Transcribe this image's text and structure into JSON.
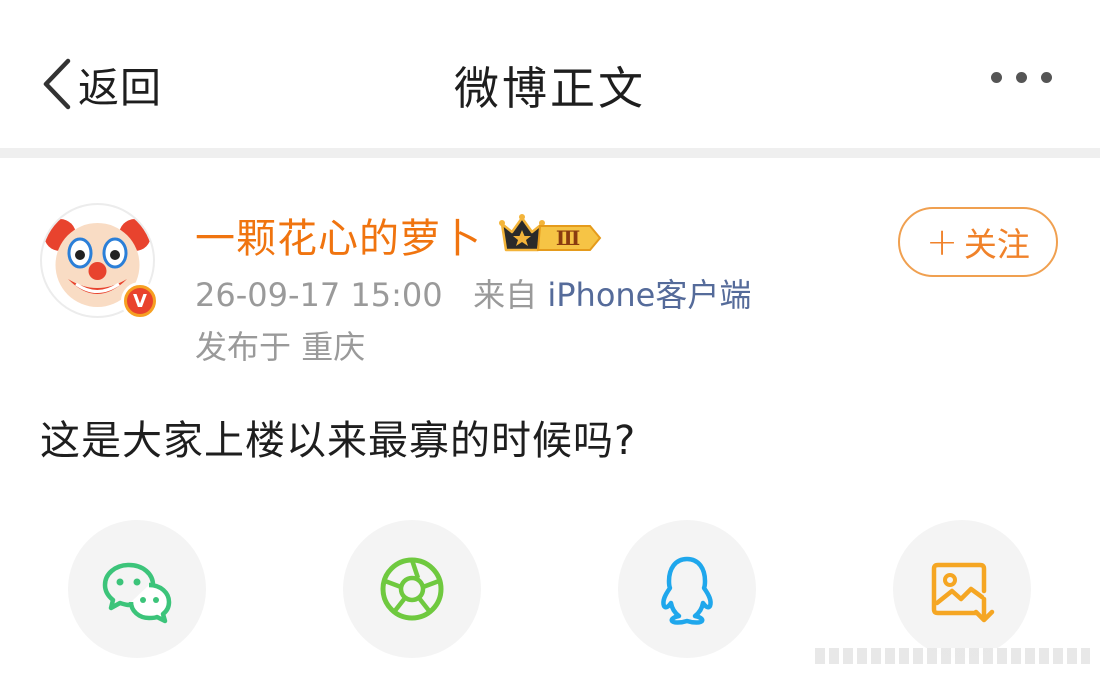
{
  "nav": {
    "back_label": "返回",
    "title": "微博正文"
  },
  "post": {
    "author": "一颗花心的萝卜",
    "vip_level": "Ⅲ",
    "verified_mark": "V",
    "timestamp": "26-09-17 15:00",
    "source_prefix": "来自",
    "source": "iPhone客户端",
    "location_prefix": "发布于",
    "location": "重庆",
    "text": "这是大家上楼以来最寡的时候吗?"
  },
  "follow": {
    "plus": "+",
    "label": "关注"
  },
  "share": {
    "icons": [
      "wechat-icon",
      "moments-icon",
      "qq-icon",
      "save-image-icon"
    ]
  },
  "colors": {
    "accent_orange": "#f0740f",
    "link_blue": "#556b9a",
    "wechat_green": "#2dc100",
    "qq_blue": "#12b7f5",
    "save_orange": "#f5a623"
  }
}
